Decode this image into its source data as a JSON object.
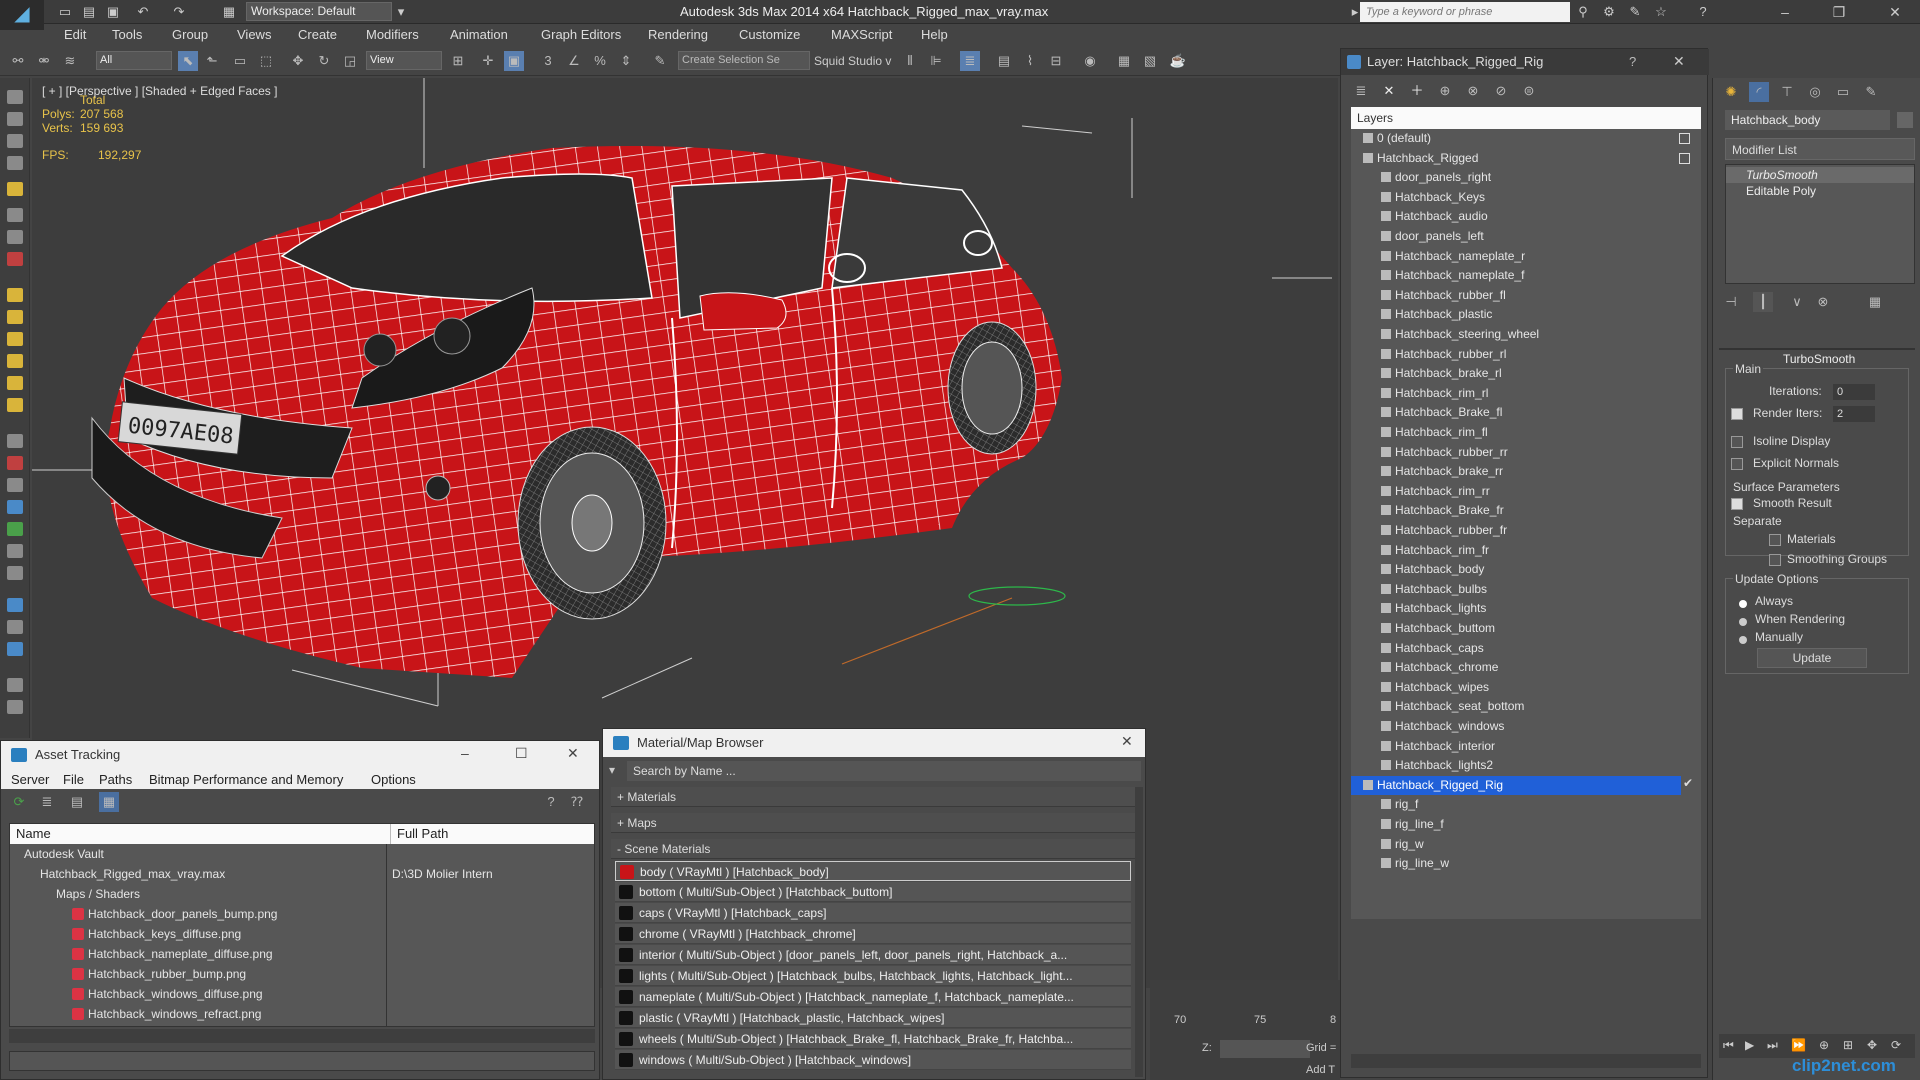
{
  "app": {
    "title": "Autodesk 3ds Max  2014 x64     Hatchback_Rigged_max_vray.max",
    "workspace": "Workspace: Default",
    "search_placeholder": "Type a keyword or phrase"
  },
  "menu": [
    "Edit",
    "Tools",
    "Group",
    "Views",
    "Create",
    "Modifiers",
    "Animation",
    "Graph Editors",
    "Rendering",
    "Customize",
    "MAXScript",
    "Help"
  ],
  "toolbar": {
    "filter_value": "All",
    "view_value": "View",
    "selection_set_placeholder": "Create Selection Se",
    "squid_label": "Squid Studio v"
  },
  "viewport": {
    "label": "[ + ] [Perspective ] [Shaded + Edged Faces ]",
    "stats_total_label": "Total",
    "polys_label": "Polys:",
    "polys_value": "207 568",
    "verts_label": "Verts:",
    "verts_value": "159 693",
    "fps_label": "FPS:",
    "fps_value": "192,297",
    "plate_text": "0097AE08"
  },
  "layer_panel": {
    "title": "Layer: Hatchback_Rigged_Rig",
    "help": "?",
    "header": "Layers",
    "layers": [
      {
        "name": "0 (default)",
        "level": 0
      },
      {
        "name": "Hatchback_Rigged",
        "level": 0
      },
      {
        "name": "door_panels_right",
        "level": 1
      },
      {
        "name": "Hatchback_Keys",
        "level": 1
      },
      {
        "name": "Hatchback_audio",
        "level": 1
      },
      {
        "name": "door_panels_left",
        "level": 1
      },
      {
        "name": "Hatchback_nameplate_r",
        "level": 1
      },
      {
        "name": "Hatchback_nameplate_f",
        "level": 1
      },
      {
        "name": "Hatchback_rubber_fl",
        "level": 1
      },
      {
        "name": "Hatchback_plastic",
        "level": 1
      },
      {
        "name": "Hatchback_steering_wheel",
        "level": 1
      },
      {
        "name": "Hatchback_rubber_rl",
        "level": 1
      },
      {
        "name": "Hatchback_brake_rl",
        "level": 1
      },
      {
        "name": "Hatchback_rim_rl",
        "level": 1
      },
      {
        "name": "Hatchback_Brake_fl",
        "level": 1
      },
      {
        "name": "Hatchback_rim_fl",
        "level": 1
      },
      {
        "name": "Hatchback_rubber_rr",
        "level": 1
      },
      {
        "name": "Hatchback_brake_rr",
        "level": 1
      },
      {
        "name": "Hatchback_rim_rr",
        "level": 1
      },
      {
        "name": "Hatchback_Brake_fr",
        "level": 1
      },
      {
        "name": "Hatchback_rubber_fr",
        "level": 1
      },
      {
        "name": "Hatchback_rim_fr",
        "level": 1
      },
      {
        "name": "Hatchback_body",
        "level": 1
      },
      {
        "name": "Hatchback_bulbs",
        "level": 1
      },
      {
        "name": "Hatchback_lights",
        "level": 1
      },
      {
        "name": "Hatchback_buttom",
        "level": 1
      },
      {
        "name": "Hatchback_caps",
        "level": 1
      },
      {
        "name": "Hatchback_chrome",
        "level": 1
      },
      {
        "name": "Hatchback_wipes",
        "level": 1
      },
      {
        "name": "Hatchback_seat_bottom",
        "level": 1
      },
      {
        "name": "Hatchback_windows",
        "level": 1
      },
      {
        "name": "Hatchback_interior",
        "level": 1
      },
      {
        "name": "Hatchback_lights2",
        "level": 1
      },
      {
        "name": "Hatchback_Rigged_Rig",
        "level": 0,
        "selected": true
      },
      {
        "name": "rig_f",
        "level": 1
      },
      {
        "name": "rig_line_f",
        "level": 1
      },
      {
        "name": "rig_w",
        "level": 1
      },
      {
        "name": "rig_line_w",
        "level": 1
      }
    ]
  },
  "command_panel": {
    "object_name": "Hatchback_body",
    "modifier_list": "Modifier List",
    "stack": [
      "TurboSmooth",
      "Editable Poly"
    ],
    "turbosmooth_title": "TurboSmooth",
    "main_label": "Main",
    "iterations_label": "Iterations:",
    "iterations_value": "0",
    "render_iters_label": "Render Iters:",
    "render_iters_value": "2",
    "isoline_label": "Isoline Display",
    "explicit_normals_label": "Explicit Normals",
    "surface_params_label": "Surface Parameters",
    "smooth_result_label": "Smooth Result",
    "separate_label": "Separate",
    "materials_label": "Materials",
    "smoothing_groups_label": "Smoothing Groups",
    "update_options_label": "Update Options",
    "always_label": "Always",
    "when_rendering_label": "When Rendering",
    "manually_label": "Manually",
    "update_button": "Update"
  },
  "asset_tracking": {
    "title": "Asset Tracking",
    "menu": [
      "Server",
      "File",
      "Paths",
      "Bitmap Performance and Memory",
      "Options"
    ],
    "col_name": "Name",
    "col_path": "Full Path",
    "rows": [
      {
        "name": "Autodesk Vault",
        "indent": 0,
        "path": ""
      },
      {
        "name": "Hatchback_Rigged_max_vray.max",
        "indent": 1,
        "path": "D:\\3D Molier Intern"
      },
      {
        "name": "Maps / Shaders",
        "indent": 2,
        "path": ""
      },
      {
        "name": "Hatchback_door_panels_bump.png",
        "indent": 3,
        "path": ""
      },
      {
        "name": "Hatchback_keys_diffuse.png",
        "indent": 3,
        "path": ""
      },
      {
        "name": "Hatchback_nameplate_diffuse.png",
        "indent": 3,
        "path": ""
      },
      {
        "name": "Hatchback_rubber_bump.png",
        "indent": 3,
        "path": ""
      },
      {
        "name": "Hatchback_windows_diffuse.png",
        "indent": 3,
        "path": ""
      },
      {
        "name": "Hatchback_windows_refract.png",
        "indent": 3,
        "path": ""
      }
    ]
  },
  "material_browser": {
    "title": "Material/Map Browser",
    "search_placeholder": "Search by Name ...",
    "categories": [
      "+ Materials",
      "+ Maps",
      "- Scene Materials"
    ],
    "materials": [
      "body  ( VRayMtl ) [Hatchback_body]",
      "bottom  ( Multi/Sub-Object ) [Hatchback_buttom]",
      "caps  ( VRayMtl ) [Hatchback_caps]",
      "chrome  ( VRayMtl ) [Hatchback_chrome]",
      "interior  ( Multi/Sub-Object ) [door_panels_left, door_panels_right, Hatchback_a...",
      "lights  ( Multi/Sub-Object ) [Hatchback_bulbs, Hatchback_lights, Hatchback_light...",
      "nameplate  ( Multi/Sub-Object ) [Hatchback_nameplate_f, Hatchback_nameplate...",
      "plastic  ( VRayMtl ) [Hatchback_plastic, Hatchback_wipes]",
      "wheels  ( Multi/Sub-Object ) [Hatchback_Brake_fl, Hatchback_Brake_fr, Hatchba...",
      "windows  ( Multi/Sub-Object ) [Hatchback_windows]"
    ]
  },
  "timeline": {
    "ticks": [
      "70",
      "75",
      "8"
    ],
    "z_label": "Z:",
    "grid_label": "Grid =",
    "add_label": "Add T"
  },
  "watermark": "clip2net.com",
  "colors": {
    "car_red": "#c81418",
    "wire": "#ffffff",
    "selected_layer": "#2060d8",
    "stats": "#e8c34a"
  }
}
